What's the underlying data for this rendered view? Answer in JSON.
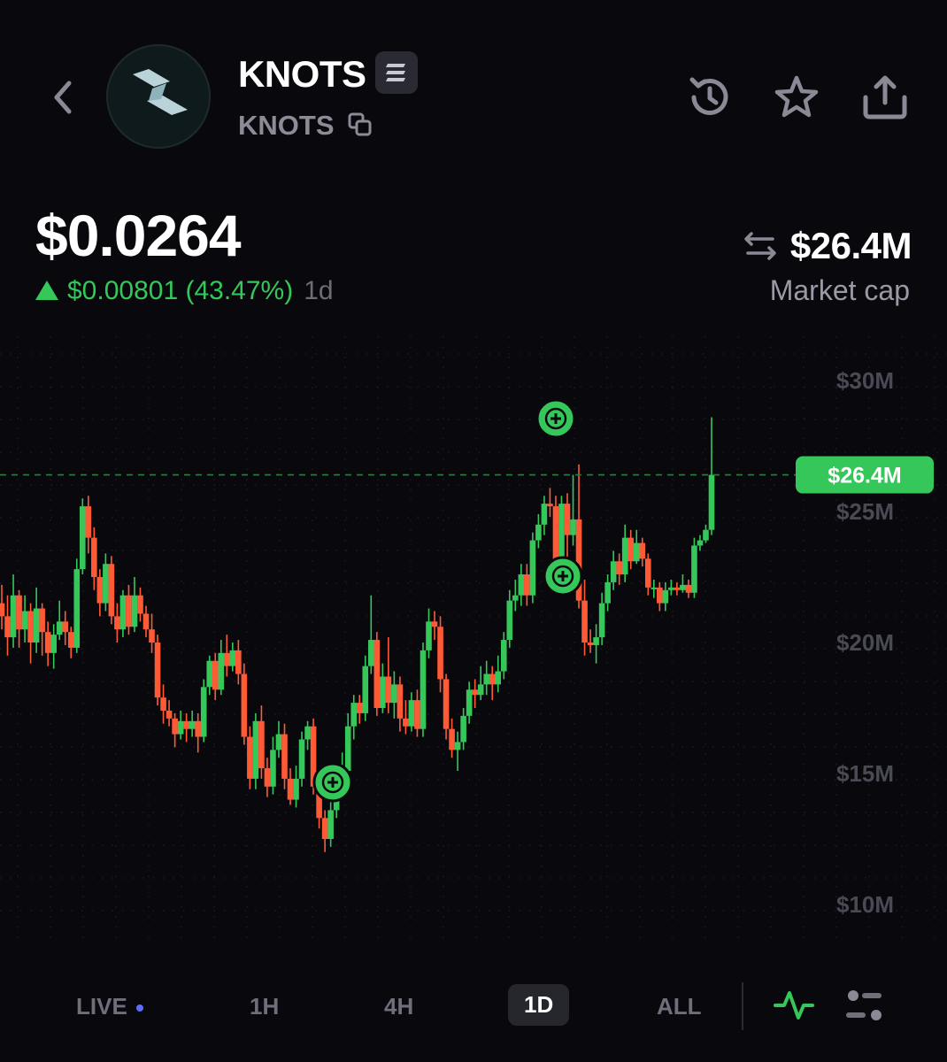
{
  "header": {
    "token_name": "KNOTS",
    "token_symbol": "KNOTS",
    "icons": [
      "back-icon",
      "token-logo",
      "chain-badge-icon",
      "copy-icon",
      "history-icon",
      "star-icon",
      "share-icon"
    ]
  },
  "price": {
    "value": "$0.0264",
    "change": "$0.00801 (43.47%)",
    "period": "1d"
  },
  "market_cap": {
    "value": "$26.4M",
    "label": "Market cap"
  },
  "colors": {
    "background": "#09090d",
    "up": "#35c759",
    "down": "#ff5a36",
    "muted": "#6f6f7c"
  },
  "timeframes": {
    "live": "LIVE",
    "h1": "1H",
    "h4": "4H",
    "d1": "1D",
    "all": "ALL",
    "selected": "1D"
  },
  "chart_data": {
    "type": "candlestick",
    "y_ticks": [
      "$30M",
      "$25M",
      "$20M",
      "$15M",
      "$10M"
    ],
    "ylim": [
      7,
      32
    ],
    "current_value": 26.4,
    "current_label": "$26.4M",
    "grid": true,
    "candles": [
      [
        21.5,
        21.0,
        22.2,
        20.5
      ],
      [
        21.0,
        20.2,
        21.8,
        19.5
      ],
      [
        20.2,
        21.8,
        22.6,
        19.8
      ],
      [
        21.8,
        20.5,
        22.0,
        19.8
      ],
      [
        20.5,
        21.2,
        21.8,
        20.0
      ],
      [
        21.2,
        20.0,
        21.5,
        19.2
      ],
      [
        20.0,
        21.3,
        22.1,
        19.6
      ],
      [
        21.3,
        20.4,
        21.5,
        19.5
      ],
      [
        20.4,
        19.6,
        20.8,
        19.1
      ],
      [
        19.6,
        20.3,
        20.7,
        19.0
      ],
      [
        20.3,
        20.8,
        21.6,
        20.1
      ],
      [
        20.8,
        20.4,
        21.2,
        19.9
      ],
      [
        20.4,
        19.8,
        20.6,
        19.4
      ],
      [
        19.8,
        22.8,
        23.2,
        19.6
      ],
      [
        22.8,
        25.2,
        25.5,
        22.6
      ],
      [
        25.2,
        24.0,
        25.6,
        23.4
      ],
      [
        24.0,
        22.5,
        24.4,
        22.0
      ],
      [
        22.5,
        21.5,
        22.8,
        21.0
      ],
      [
        21.5,
        23.0,
        23.4,
        21.2
      ],
      [
        23.0,
        21.0,
        23.3,
        20.7
      ],
      [
        21.0,
        20.5,
        21.5,
        20.0
      ],
      [
        20.5,
        21.8,
        22.0,
        20.2
      ],
      [
        21.8,
        20.6,
        22.2,
        20.3
      ],
      [
        20.6,
        21.8,
        22.5,
        20.4
      ],
      [
        21.8,
        21.1,
        22.1,
        20.8
      ],
      [
        21.1,
        20.5,
        21.4,
        20.2
      ],
      [
        20.5,
        20.0,
        21.1,
        19.6
      ],
      [
        20.0,
        17.9,
        20.3,
        17.6
      ],
      [
        17.9,
        17.4,
        18.4,
        16.9
      ],
      [
        17.4,
        17.1,
        17.8,
        16.8
      ],
      [
        17.1,
        16.5,
        17.3,
        16.0
      ],
      [
        16.5,
        17.0,
        17.4,
        16.3
      ],
      [
        17.0,
        16.7,
        17.3,
        16.2
      ],
      [
        16.7,
        17.0,
        17.4,
        16.4
      ],
      [
        17.0,
        16.4,
        17.3,
        15.8
      ],
      [
        16.4,
        18.3,
        18.6,
        16.2
      ],
      [
        18.3,
        19.3,
        19.5,
        18.0
      ],
      [
        19.3,
        18.2,
        19.6,
        17.8
      ],
      [
        18.2,
        19.6,
        20.1,
        18.0
      ],
      [
        19.6,
        19.1,
        20.3,
        18.7
      ],
      [
        19.1,
        19.7,
        20.0,
        18.9
      ],
      [
        19.7,
        18.8,
        20.1,
        18.4
      ],
      [
        18.8,
        16.4,
        19.2,
        16.1
      ],
      [
        16.4,
        14.8,
        16.8,
        14.4
      ],
      [
        14.8,
        17.0,
        17.3,
        14.4
      ],
      [
        17.0,
        15.2,
        17.6,
        14.8
      ],
      [
        15.2,
        14.5,
        15.6,
        14.1
      ],
      [
        14.5,
        15.9,
        16.4,
        14.2
      ],
      [
        15.9,
        16.5,
        17.0,
        15.6
      ],
      [
        16.5,
        14.8,
        16.9,
        14.4
      ],
      [
        14.8,
        14.0,
        15.2,
        13.8
      ],
      [
        14.0,
        14.8,
        15.3,
        13.7
      ],
      [
        14.8,
        16.3,
        16.6,
        14.5
      ],
      [
        16.3,
        16.8,
        17.0,
        15.9
      ],
      [
        16.8,
        14.5,
        17.1,
        14.2
      ],
      [
        14.5,
        13.3,
        14.8,
        12.9
      ],
      [
        13.3,
        12.5,
        13.6,
        12.0
      ],
      [
        12.5,
        13.6,
        14.0,
        12.2
      ],
      [
        13.6,
        14.8,
        15.2,
        13.3
      ],
      [
        14.8,
        15.1,
        15.8,
        14.5
      ],
      [
        15.1,
        16.8,
        17.3,
        14.9
      ],
      [
        16.8,
        17.7,
        18.0,
        16.3
      ],
      [
        17.7,
        17.3,
        18.0,
        16.9
      ],
      [
        17.3,
        19.1,
        19.5,
        17.0
      ],
      [
        19.1,
        20.1,
        21.8,
        18.8
      ],
      [
        20.1,
        17.5,
        20.4,
        17.2
      ],
      [
        17.5,
        18.7,
        19.2,
        17.3
      ],
      [
        18.7,
        17.7,
        20.2,
        17.3
      ],
      [
        17.7,
        18.4,
        18.9,
        17.1
      ],
      [
        18.4,
        17.1,
        18.7,
        16.6
      ],
      [
        17.1,
        16.8,
        17.8,
        16.5
      ],
      [
        16.8,
        17.8,
        18.1,
        16.6
      ],
      [
        17.8,
        16.7,
        18.2,
        16.4
      ],
      [
        16.7,
        19.7,
        20.0,
        16.4
      ],
      [
        19.7,
        20.8,
        21.3,
        19.4
      ],
      [
        20.8,
        20.6,
        21.2,
        20.1
      ],
      [
        20.6,
        18.6,
        21.0,
        18.1
      ],
      [
        18.6,
        16.7,
        18.8,
        16.3
      ],
      [
        16.7,
        15.9,
        17.1,
        15.6
      ],
      [
        15.9,
        16.2,
        16.6,
        15.1
      ],
      [
        16.2,
        17.2,
        17.5,
        15.9
      ],
      [
        17.2,
        18.2,
        18.5,
        16.9
      ],
      [
        18.2,
        18.0,
        18.6,
        17.5
      ],
      [
        18.0,
        18.4,
        19.1,
        17.8
      ],
      [
        18.4,
        18.8,
        19.3,
        18.0
      ],
      [
        18.8,
        18.4,
        19.1,
        17.8
      ],
      [
        18.4,
        18.9,
        19.5,
        18.1
      ],
      [
        18.9,
        20.1,
        20.4,
        18.6
      ],
      [
        20.1,
        21.6,
        22.0,
        19.8
      ],
      [
        21.6,
        21.8,
        22.4,
        21.2
      ],
      [
        21.8,
        22.6,
        23.0,
        21.4
      ],
      [
        22.6,
        21.8,
        23.0,
        21.4
      ],
      [
        21.8,
        23.9,
        24.2,
        21.5
      ],
      [
        23.9,
        24.5,
        24.9,
        23.6
      ],
      [
        24.5,
        25.3,
        25.6,
        24.1
      ],
      [
        25.3,
        25.2,
        25.9,
        24.8
      ],
      [
        25.2,
        22.5,
        25.6,
        21.9
      ],
      [
        22.5,
        25.3,
        25.6,
        21.8
      ],
      [
        25.3,
        24.1,
        25.7,
        22.1
      ],
      [
        24.1,
        24.7,
        26.4,
        23.7
      ],
      [
        24.7,
        21.6,
        26.8,
        21.3
      ],
      [
        21.6,
        20.0,
        22.4,
        19.5
      ],
      [
        20.0,
        19.9,
        20.5,
        19.6
      ],
      [
        19.9,
        20.2,
        20.7,
        19.2
      ],
      [
        20.2,
        21.5,
        21.9,
        19.9
      ],
      [
        21.5,
        22.3,
        22.6,
        21.2
      ],
      [
        22.3,
        23.1,
        23.5,
        22.0
      ],
      [
        23.1,
        22.6,
        23.4,
        22.2
      ],
      [
        22.6,
        24.0,
        24.5,
        22.3
      ],
      [
        24.0,
        23.1,
        24.3,
        22.8
      ],
      [
        23.1,
        23.8,
        24.3,
        23.0
      ],
      [
        23.8,
        23.2,
        24.0,
        22.9
      ],
      [
        23.2,
        22.1,
        23.4,
        21.8
      ],
      [
        22.1,
        22.1,
        22.4,
        21.7
      ],
      [
        22.1,
        21.5,
        22.3,
        21.2
      ],
      [
        21.5,
        22.0,
        22.3,
        21.2
      ],
      [
        22.0,
        22.1,
        22.4,
        21.8
      ],
      [
        22.1,
        22.0,
        22.3,
        21.8
      ],
      [
        22.0,
        22.2,
        22.6,
        21.9
      ],
      [
        22.2,
        21.9,
        22.4,
        21.7
      ],
      [
        21.9,
        23.7,
        24.0,
        21.7
      ],
      [
        23.7,
        23.9,
        24.1,
        23.5
      ],
      [
        23.9,
        24.3,
        24.5,
        23.8
      ],
      [
        24.3,
        26.4,
        28.6,
        24.1
      ]
    ]
  }
}
